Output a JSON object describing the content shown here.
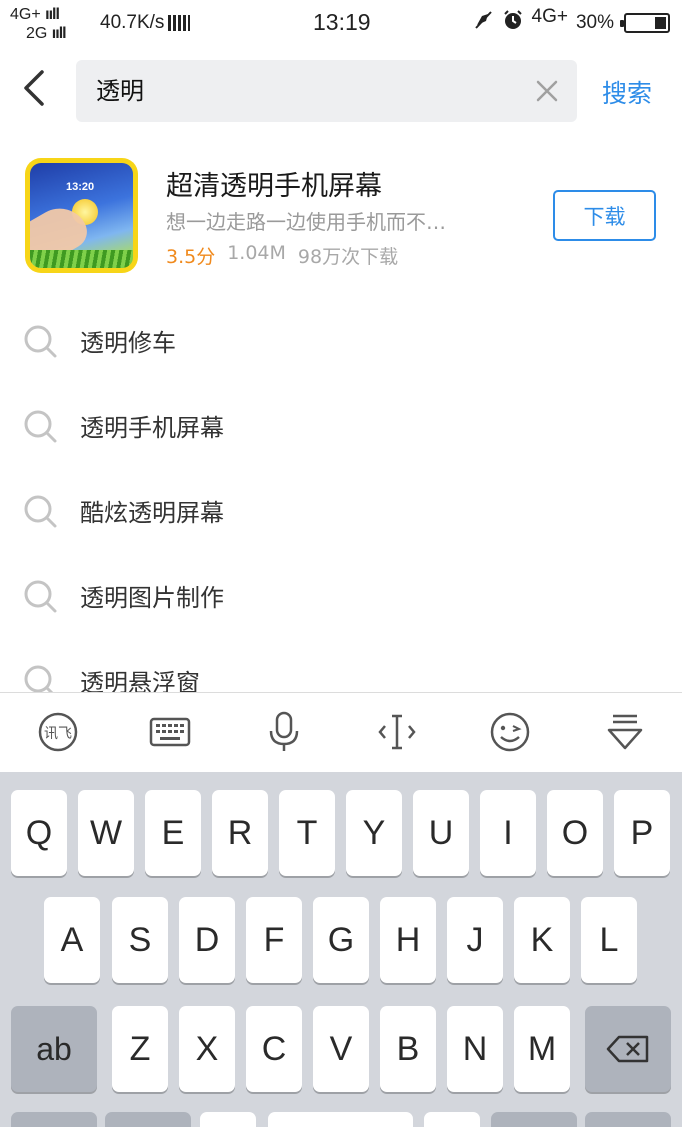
{
  "status_bar": {
    "network_top": "4G+",
    "network_bottom": "2G",
    "speed": "40.7K/s",
    "time": "13:19",
    "network_right": "4G+",
    "battery_percent": "30%",
    "battery_level": 0.3
  },
  "search": {
    "query": "透明",
    "submit_label": "搜索"
  },
  "app_result": {
    "name": "超清透明手机屏幕",
    "description": "想一边走路一边使用手机而不…",
    "rating": "3.5分",
    "size": "1.04M",
    "downloads": "98万次下载",
    "download_label": "下载",
    "icon_clock": "13:20"
  },
  "suggestions": [
    "透明修车",
    "透明手机屏幕",
    "酷炫透明屏幕",
    "透明图片制作",
    "透明悬浮窗"
  ],
  "keyboard": {
    "row1": [
      "Q",
      "W",
      "E",
      "R",
      "T",
      "Y",
      "U",
      "I",
      "O",
      "P"
    ],
    "row2": [
      "A",
      "S",
      "D",
      "F",
      "G",
      "H",
      "J",
      "K",
      "L"
    ],
    "row3": [
      "Z",
      "X",
      "C",
      "V",
      "B",
      "N",
      "M"
    ],
    "mode_key": "ab",
    "toolbar_icons": [
      "xunfei-logo-icon",
      "keyboard-icon",
      "microphone-icon",
      "cursor-icon",
      "emoji-icon",
      "collapse-keyboard-icon"
    ]
  },
  "colors": {
    "accent": "#2d8ce8",
    "rating": "#f08a1d",
    "keyboard_bg": "#d3d6dc"
  }
}
